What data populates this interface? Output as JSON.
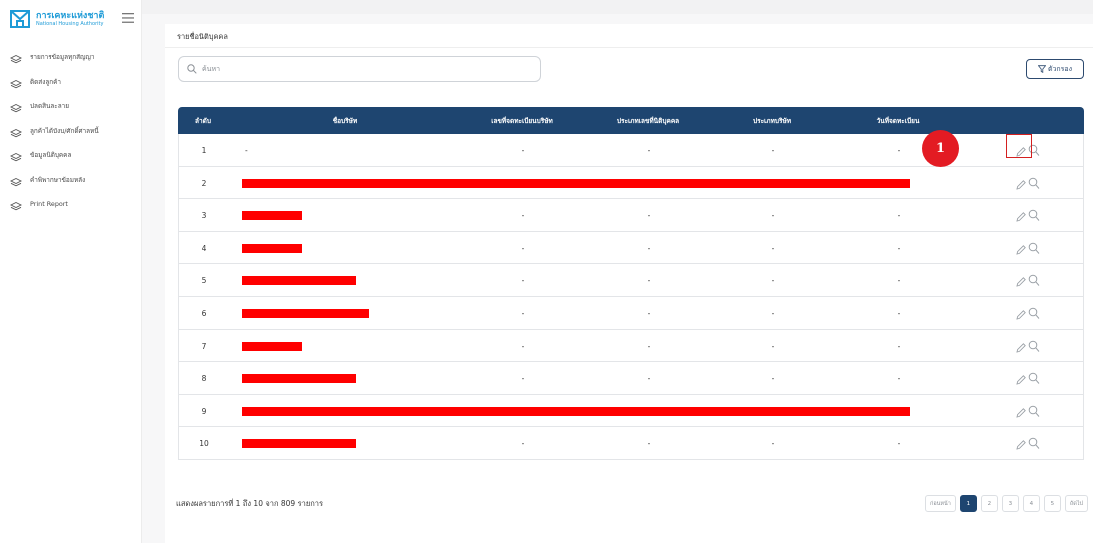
{
  "sidebar": {
    "logo": {
      "th": "การเคหะแห่งชาติ",
      "en": "National Housing Authority"
    },
    "items": [
      {
        "label": "รายการข้อมูลทุกสัญญา"
      },
      {
        "label": "ติดส่งลูกค้า"
      },
      {
        "label": "ปลดสินละลาย"
      },
      {
        "label": "ลูกค้าได้บังบ/ศักดิ์ศาลหนี้"
      },
      {
        "label": "ข้อมูลนิติบุคคล"
      },
      {
        "label": "คำพิพากษาข้อมหลัง"
      },
      {
        "label": "Print Report"
      }
    ]
  },
  "header": {
    "title": "รายชื่อนิติบุคคล"
  },
  "search": {
    "placeholder": "ค้นหา"
  },
  "filter": {
    "label": "ตัวกรอง"
  },
  "table": {
    "columns": [
      "ลำดับ",
      "ชื่อบริษัท",
      "เลขที่จดทะเบียนบริษัท",
      "ประเภทเลขที่นิติบุคคล",
      "ประเภทบริษัท",
      "วันที่จดทะเบียน"
    ],
    "rows": [
      {
        "no": "1",
        "name": "-",
        "c3": "-",
        "c4": "-",
        "c5": "-",
        "c6": "-",
        "redact": 0
      },
      {
        "no": "2",
        "name": "",
        "c3": "",
        "c4": "",
        "c5": "",
        "c6": "",
        "redact": 1
      },
      {
        "no": "3",
        "name": "",
        "c3": "-",
        "c4": "-",
        "c5": "-",
        "c6": "-",
        "redact": 0.09
      },
      {
        "no": "4",
        "name": "",
        "c3": "-",
        "c4": "-",
        "c5": "-",
        "c6": "-",
        "redact": 0.09
      },
      {
        "no": "5",
        "name": "",
        "c3": "-",
        "c4": "-",
        "c5": "-",
        "c6": "-",
        "redact": 0.17
      },
      {
        "no": "6",
        "name": "",
        "c3": "-",
        "c4": "-",
        "c5": "-",
        "c6": "-",
        "redact": 0.19
      },
      {
        "no": "7",
        "name": "",
        "c3": "-",
        "c4": "-",
        "c5": "-",
        "c6": "-",
        "redact": 0.09
      },
      {
        "no": "8",
        "name": "",
        "c3": "-",
        "c4": "-",
        "c5": "-",
        "c6": "-",
        "redact": 0.17
      },
      {
        "no": "9",
        "name": "",
        "c3": "",
        "c4": "",
        "c5": "",
        "c6": "",
        "redact": 1
      },
      {
        "no": "10",
        "name": "",
        "c3": "-",
        "c4": "-",
        "c5": "-",
        "c6": "-",
        "redact": 0.17
      }
    ]
  },
  "annotation": {
    "step": "1"
  },
  "footer": {
    "summary": "แสดงผลรายการที่ 1 ถึง 10 จาก 809 รายการ"
  },
  "pagination": {
    "prev": "ก่อนหน้า",
    "pages": [
      "1",
      "2",
      "3",
      "4",
      "5"
    ],
    "active": "1",
    "next": "ถัดไป"
  },
  "colors": {
    "header": "#1e4570",
    "accent": "#1e9bd7",
    "redaction": "#ff0000",
    "highlight": "#e31b23"
  },
  "icons": {
    "edit": "pencil-icon",
    "view": "magnifier-icon",
    "menu": "layers-icon",
    "filter": "funnel-icon"
  }
}
